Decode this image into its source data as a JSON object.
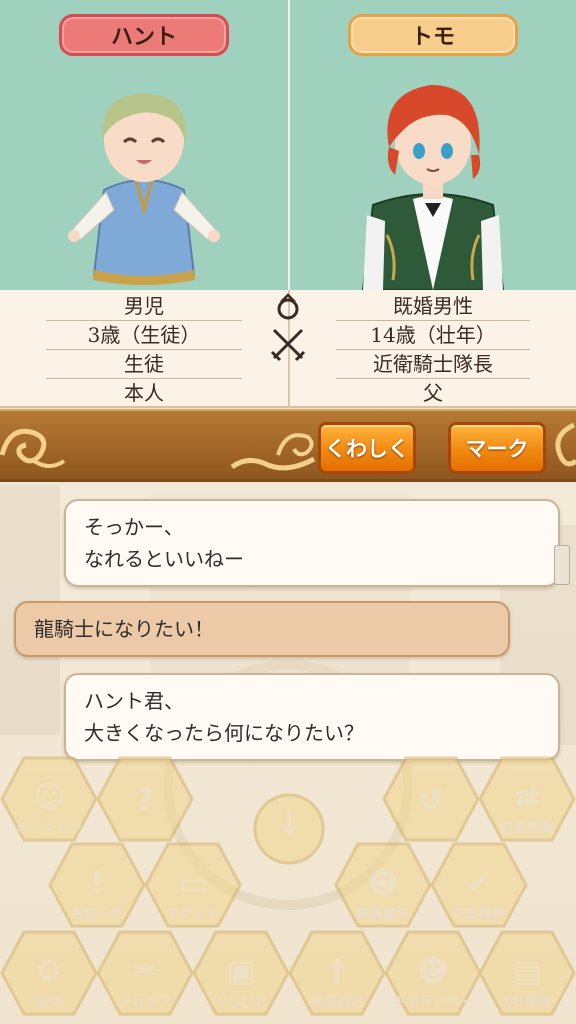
{
  "characters": {
    "left": {
      "name": "ハント",
      "pill_color": "#ec7b78"
    },
    "right": {
      "name": "トモ",
      "pill_color": "#f7cd8b"
    }
  },
  "info": {
    "left": [
      "男児",
      "3歳（生徒）",
      "生徒",
      "本人"
    ],
    "right": [
      "既婚男性",
      "14歳（壮年）",
      "近衛騎士隊長",
      "父"
    ],
    "icons": [
      "ring-icon",
      "crossed-swords-icon"
    ]
  },
  "actions": {
    "details_label": "くわしく",
    "mark_label": "マーク"
  },
  "chat": {
    "messages": [
      {
        "text": "そっかー、\nなれるといいねー",
        "style": "white"
      },
      {
        "text": "龍騎士になりたい！",
        "style": "tan"
      },
      {
        "text": "ハント君、\n大きくなったら何になりたい？",
        "style": "white"
      }
    ]
  },
  "menu": {
    "items": [
      {
        "label": "ミッション",
        "icon": "mission-icon"
      },
      {
        "label": "",
        "icon": "help-icon"
      },
      {
        "label": "",
        "icon": "down-arrow-icon"
      },
      {
        "label": "",
        "icon": "dragon-icon"
      },
      {
        "label": "自動移動",
        "icon": "auto-move-icon"
      },
      {
        "label": "お知らせ",
        "icon": "notice-icon"
      },
      {
        "label": "チケット",
        "icon": "ticket-icon"
      },
      {
        "label": "",
        "icon": "house-icon"
      },
      {
        "label": "鍛錬魔法",
        "icon": "magic-icon"
      },
      {
        "label": "交友関係",
        "icon": "relations-icon"
      },
      {
        "label": "設定",
        "icon": "settings-icon"
      },
      {
        "label": "ショップ",
        "icon": "shop-icon"
      },
      {
        "label": "くしびき",
        "icon": "lottery-icon"
      },
      {
        "label": "武器設定",
        "icon": "weapon-icon"
      },
      {
        "label": "キャラクター",
        "icon": "character-icon"
      },
      {
        "label": "1日情報",
        "icon": "daily-info-icon"
      }
    ]
  }
}
